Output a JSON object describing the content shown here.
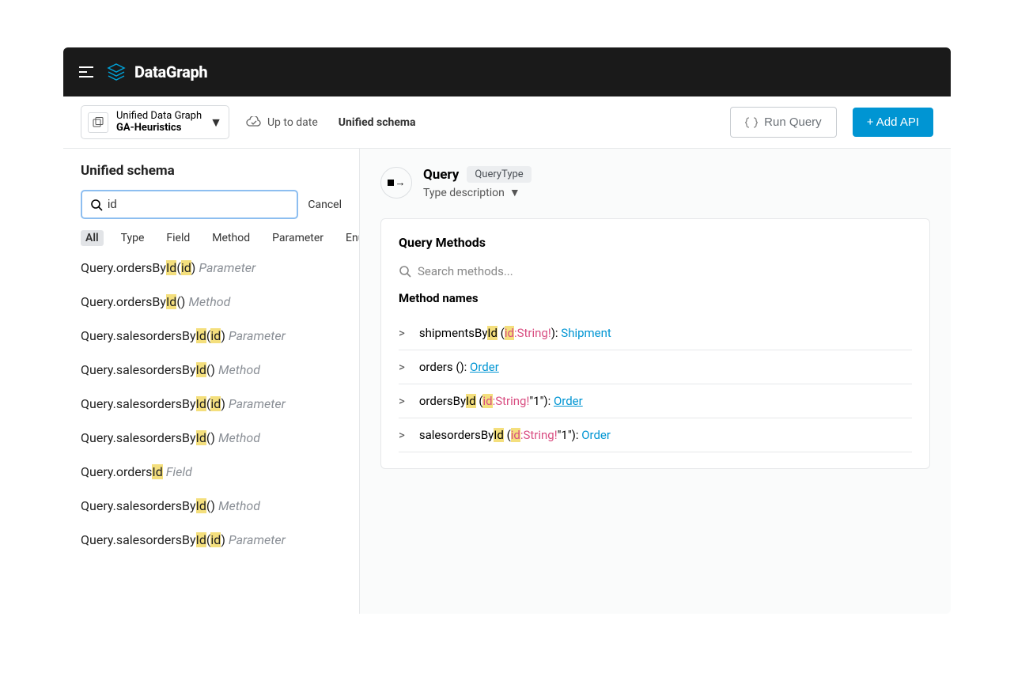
{
  "header": {
    "product": "DataGraph",
    "graph_line1": "Unified Data Graph",
    "graph_line2": "GA-Heuristics",
    "status": "Up to date",
    "breadcrumb": "Unified schema",
    "run_label": "Run Query",
    "add_label": "+ Add API"
  },
  "sidebar": {
    "title": "Unified schema",
    "query": "id",
    "cancel": "Cancel",
    "tabs": [
      "All",
      "Type",
      "Field",
      "Method",
      "Parameter",
      "Enum"
    ],
    "results": [
      {
        "pre": "Query.ordersBy",
        "h1": "Id",
        "mid": "(",
        "h2": "id",
        "tail": ")",
        "kind": "Parameter"
      },
      {
        "pre": "Query.ordersBy",
        "h1": "Id",
        "mid": "()",
        "h2": "",
        "tail": "",
        "kind": "Method"
      },
      {
        "pre": "Query.salesordersBy",
        "h1": "Id",
        "mid": "(",
        "h2": "id",
        "tail": ")",
        "kind": "Parameter"
      },
      {
        "pre": "Query.salesordersBy",
        "h1": "Id",
        "mid": "()",
        "h2": "",
        "tail": "",
        "kind": "Method"
      },
      {
        "pre": "Query.salesordersBy",
        "h1": "Id",
        "mid": "(",
        "h2": "id",
        "tail": ")",
        "kind": "Parameter"
      },
      {
        "pre": "Query.salesordersBy",
        "h1": "Id",
        "mid": "()",
        "h2": "",
        "tail": "",
        "kind": "Method"
      },
      {
        "pre": "Query.orders",
        "h1": "Id",
        "mid": "",
        "h2": "",
        "tail": "",
        "kind": "Field"
      },
      {
        "pre": "Query.salesordersBy",
        "h1": "Id",
        "mid": "()",
        "h2": "",
        "tail": "",
        "kind": "Method"
      },
      {
        "pre": "Query.salesordersBy",
        "h1": "Id",
        "mid": "(",
        "h2": "id",
        "tail": ")",
        "kind": "Parameter"
      }
    ]
  },
  "main": {
    "type_name": "Query",
    "type_badge": "QueryType",
    "type_desc": "Type description",
    "methods_title": "Query Methods",
    "methods_search_placeholder": "Search methods...",
    "col_header": "Method names",
    "methods": [
      {
        "name_pre": "shipmentsBy",
        "name_hl": "Id",
        "has_id_param": true,
        "type_str": ":String!",
        "extra": ")",
        "ret": "Shipment",
        "ret_link": false
      },
      {
        "name_pre": "orders",
        "name_hl": "",
        "has_id_param": false,
        "type_str": "",
        "extra": "()",
        "ret": "Order",
        "ret_link": true
      },
      {
        "name_pre": "ordersBy",
        "name_hl": "Id",
        "has_id_param": true,
        "type_str": ":String!",
        "extra": "\"1\")",
        "ret": "Order",
        "ret_link": true
      },
      {
        "name_pre": "salesordersBy",
        "name_hl": "Id",
        "has_id_param": true,
        "type_str": ":String!",
        "extra": "\"1\")",
        "ret": "Order",
        "ret_link": false
      }
    ]
  }
}
